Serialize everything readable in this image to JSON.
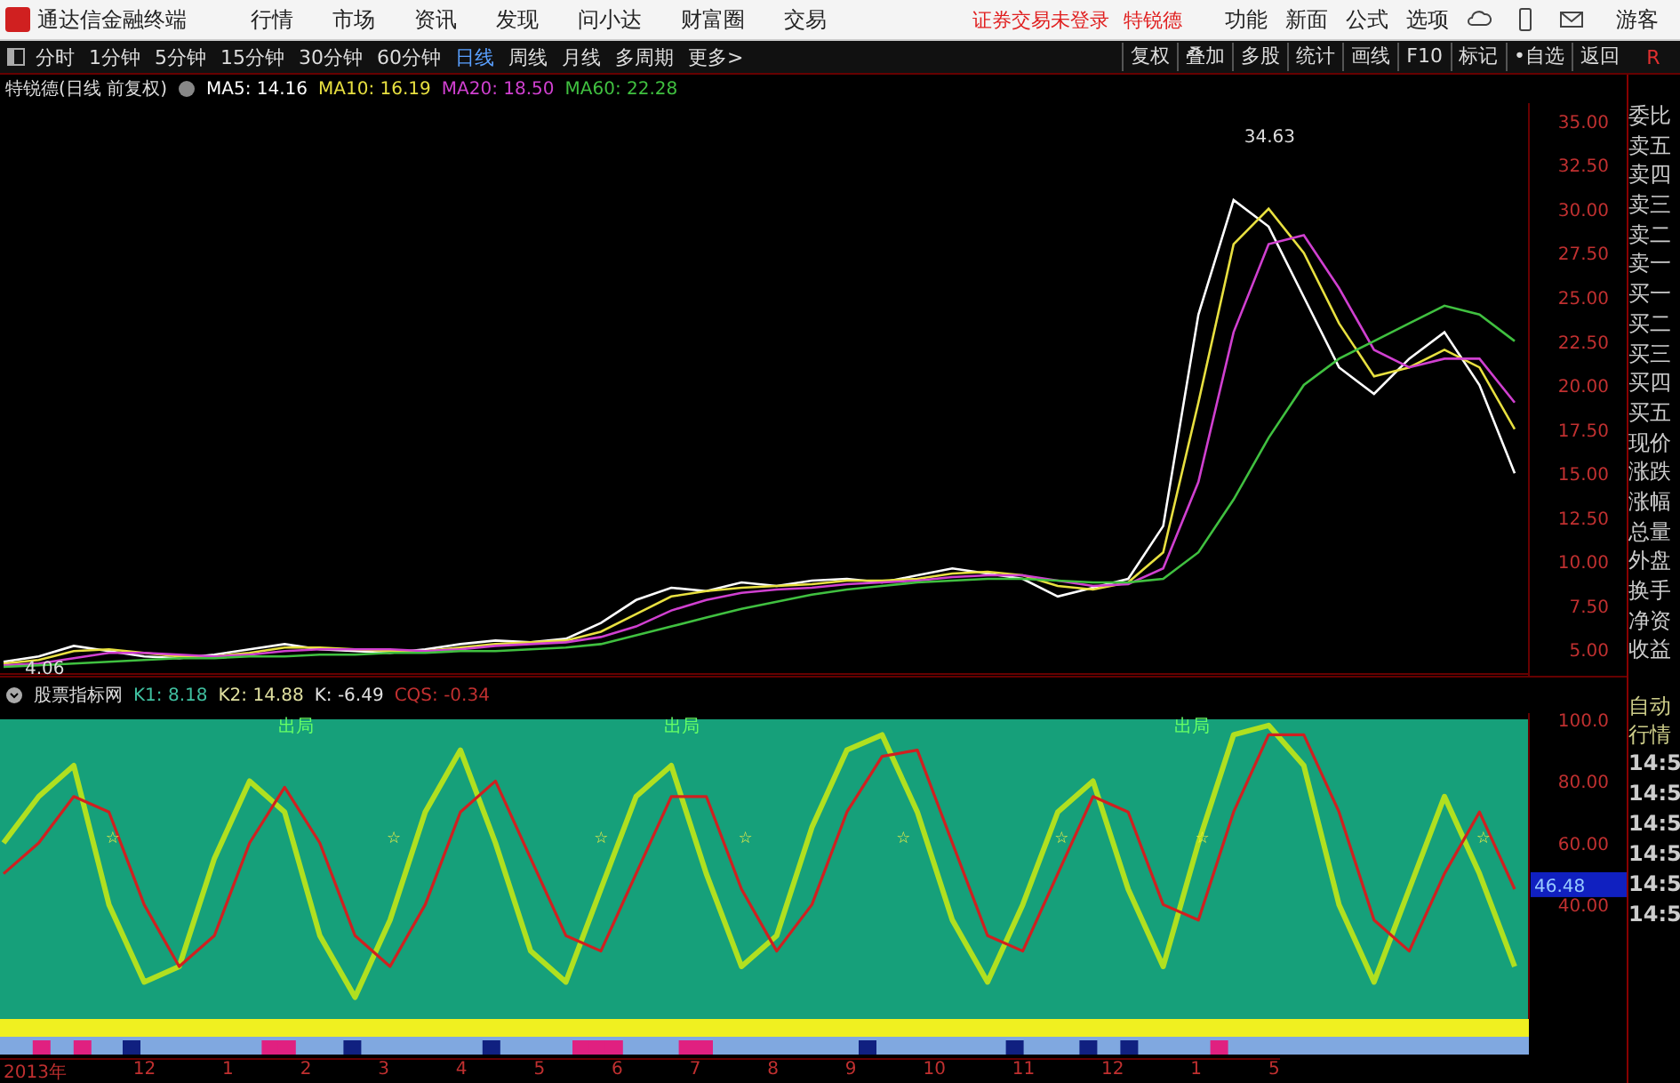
{
  "window": {
    "app_title": "通达信金融终端",
    "menus": [
      "行情",
      "市场",
      "资讯",
      "发现",
      "问小达",
      "财富圈",
      "交易"
    ],
    "login_status": "证券交易未登录",
    "stock_name": "特锐德",
    "right_menus": [
      "功能",
      "新面",
      "公式",
      "选项"
    ],
    "user": "游客"
  },
  "toolbar": {
    "periods": [
      {
        "label": "分时",
        "selected": false
      },
      {
        "label": "1分钟",
        "selected": false
      },
      {
        "label": "5分钟",
        "selected": false
      },
      {
        "label": "15分钟",
        "selected": false
      },
      {
        "label": "30分钟",
        "selected": false
      },
      {
        "label": "60分钟",
        "selected": false
      },
      {
        "label": "日线",
        "selected": true
      },
      {
        "label": "周线",
        "selected": false
      },
      {
        "label": "月线",
        "selected": false
      },
      {
        "label": "多周期",
        "selected": false
      }
    ],
    "more": "更多>",
    "actions": [
      "复权",
      "叠加",
      "多股",
      "统计",
      "画线",
      "F10",
      "标记",
      "•自选",
      "返回"
    ],
    "edge_label": "R"
  },
  "main_chart": {
    "title": "特锐德(日线 前复权)",
    "indicators": [
      {
        "label": "MA5: 14.16",
        "color": "#ffffff"
      },
      {
        "label": "MA10: 16.19",
        "color": "#e8e040"
      },
      {
        "label": "MA20: 18.50",
        "color": "#d040d0"
      },
      {
        "label": "MA60: 22.28",
        "color": "#40c040"
      }
    ],
    "chart_data": {
      "type": "line",
      "ylim": [
        3.5,
        36
      ],
      "yticks": [
        {
          "value": 5,
          "label": "5.00"
        },
        {
          "value": 7.5,
          "label": "7.50"
        },
        {
          "value": 10,
          "label": "10.00"
        },
        {
          "value": 12.5,
          "label": "12.50"
        },
        {
          "value": 15,
          "label": "15.00"
        },
        {
          "value": 17.5,
          "label": "17.50"
        },
        {
          "value": 20,
          "label": "20.00"
        },
        {
          "value": 22.5,
          "label": "22.50"
        },
        {
          "value": 25,
          "label": "25.00"
        },
        {
          "value": 27.5,
          "label": "27.50"
        },
        {
          "value": 30,
          "label": "30.00"
        },
        {
          "value": 32.5,
          "label": "32.50"
        },
        {
          "value": 35,
          "label": "35.00"
        }
      ],
      "series": [
        {
          "color": "#ffffff",
          "values": [
            4.3,
            4.6,
            5.2,
            4.9,
            4.6,
            4.5,
            4.7,
            5.0,
            5.3,
            5.0,
            4.9,
            4.8,
            5.0,
            5.3,
            5.5,
            5.4,
            5.6,
            6.5,
            7.8,
            8.5,
            8.3,
            8.8,
            8.6,
            8.9,
            9.0,
            8.8,
            9.2,
            9.6,
            9.3,
            9.0,
            8.0,
            8.5,
            9.0,
            12.0,
            24.0,
            30.5,
            29.0,
            25.0,
            21.0,
            19.5,
            21.5,
            23.0,
            20.0,
            15.0
          ]
        },
        {
          "color": "#e8e040",
          "values": [
            4.2,
            4.4,
            4.9,
            5.0,
            4.8,
            4.6,
            4.6,
            4.8,
            5.1,
            5.1,
            5.0,
            4.9,
            4.9,
            5.1,
            5.3,
            5.4,
            5.5,
            6.0,
            7.0,
            8.0,
            8.3,
            8.5,
            8.6,
            8.7,
            8.9,
            8.9,
            9.0,
            9.3,
            9.4,
            9.2,
            8.6,
            8.4,
            8.8,
            10.5,
            19.0,
            28.0,
            30.0,
            27.5,
            23.5,
            20.5,
            21.0,
            22.0,
            21.0,
            17.5
          ]
        },
        {
          "color": "#d040d0",
          "values": [
            4.1,
            4.2,
            4.5,
            4.8,
            4.8,
            4.7,
            4.6,
            4.7,
            4.9,
            5.0,
            5.0,
            5.0,
            4.9,
            5.0,
            5.2,
            5.3,
            5.4,
            5.7,
            6.3,
            7.2,
            7.8,
            8.2,
            8.4,
            8.5,
            8.7,
            8.8,
            8.9,
            9.1,
            9.2,
            9.2,
            8.9,
            8.6,
            8.7,
            9.6,
            14.5,
            23.0,
            28.0,
            28.5,
            25.5,
            22.0,
            21.0,
            21.5,
            21.5,
            19.0
          ]
        },
        {
          "color": "#40c040",
          "values": [
            4.0,
            4.1,
            4.2,
            4.3,
            4.4,
            4.5,
            4.5,
            4.6,
            4.6,
            4.7,
            4.7,
            4.8,
            4.8,
            4.9,
            4.9,
            5.0,
            5.1,
            5.3,
            5.8,
            6.3,
            6.8,
            7.3,
            7.7,
            8.1,
            8.4,
            8.6,
            8.8,
            8.9,
            9.0,
            9.0,
            8.9,
            8.8,
            8.8,
            9.0,
            10.5,
            13.5,
            17.0,
            20.0,
            21.5,
            22.5,
            23.5,
            24.5,
            24.0,
            22.5
          ]
        }
      ],
      "annotations": [
        "34.63",
        "4.06"
      ]
    }
  },
  "indicator_panel": {
    "title": "股票指标网",
    "values": [
      {
        "label": "K1: 8.18",
        "color": "#40c0a0"
      },
      {
        "label": "K2: 14.88",
        "color": "#e0e0a0"
      },
      {
        "label": "K: -6.49",
        "color": "#e0e0e0"
      },
      {
        "label": "CQS: -0.34",
        "color": "#c03030"
      }
    ],
    "current_value": "46.48",
    "chart_data": {
      "type": "line",
      "ylim": [
        3,
        102
      ],
      "yticks": [
        {
          "value": 40,
          "label": "40.00"
        },
        {
          "value": 60,
          "label": "60.00"
        },
        {
          "value": 80,
          "label": "80.00"
        },
        {
          "value": 100,
          "label": "100.0"
        }
      ],
      "series": [
        {
          "color": "#b0e020",
          "values": [
            60,
            75,
            85,
            40,
            15,
            20,
            55,
            80,
            70,
            30,
            10,
            35,
            70,
            90,
            60,
            25,
            15,
            45,
            75,
            85,
            50,
            20,
            30,
            65,
            90,
            95,
            70,
            35,
            15,
            40,
            70,
            80,
            45,
            20,
            60,
            95,
            98,
            85,
            40,
            15,
            45,
            75,
            50,
            20
          ]
        },
        {
          "color": "#d02020",
          "values": [
            50,
            60,
            75,
            70,
            40,
            20,
            30,
            60,
            78,
            60,
            30,
            20,
            40,
            70,
            80,
            55,
            30,
            25,
            50,
            75,
            75,
            45,
            25,
            40,
            70,
            88,
            90,
            60,
            30,
            25,
            50,
            75,
            70,
            40,
            35,
            70,
            95,
            95,
            70,
            35,
            25,
            50,
            70,
            45
          ]
        }
      ],
      "annotations": [
        "出局",
        "出局",
        "出局"
      ]
    },
    "markers": [
      "☆",
      "☆",
      "☆",
      "☆",
      "☆",
      "☆",
      "☆",
      "☆"
    ]
  },
  "date_axis": [
    "2013年",
    "12",
    "1",
    "2",
    "3",
    "4",
    "5",
    "6",
    "7",
    "8",
    "9",
    "10",
    "11",
    "12",
    "1",
    "5"
  ],
  "quote_panel": {
    "fields": [
      "委比",
      "卖五",
      "卖四",
      "卖三",
      "卖二",
      "卖一",
      "买一",
      "买二",
      "买三",
      "买四",
      "买五",
      "现价",
      "涨跌",
      "涨幅",
      "总量",
      "外盘",
      "换手",
      "净资",
      "收益"
    ],
    "tabs": [
      "自动",
      "行情"
    ],
    "times": [
      "14:5",
      "14:5",
      "14:5",
      "14:5",
      "14:5",
      "14:5"
    ]
  }
}
